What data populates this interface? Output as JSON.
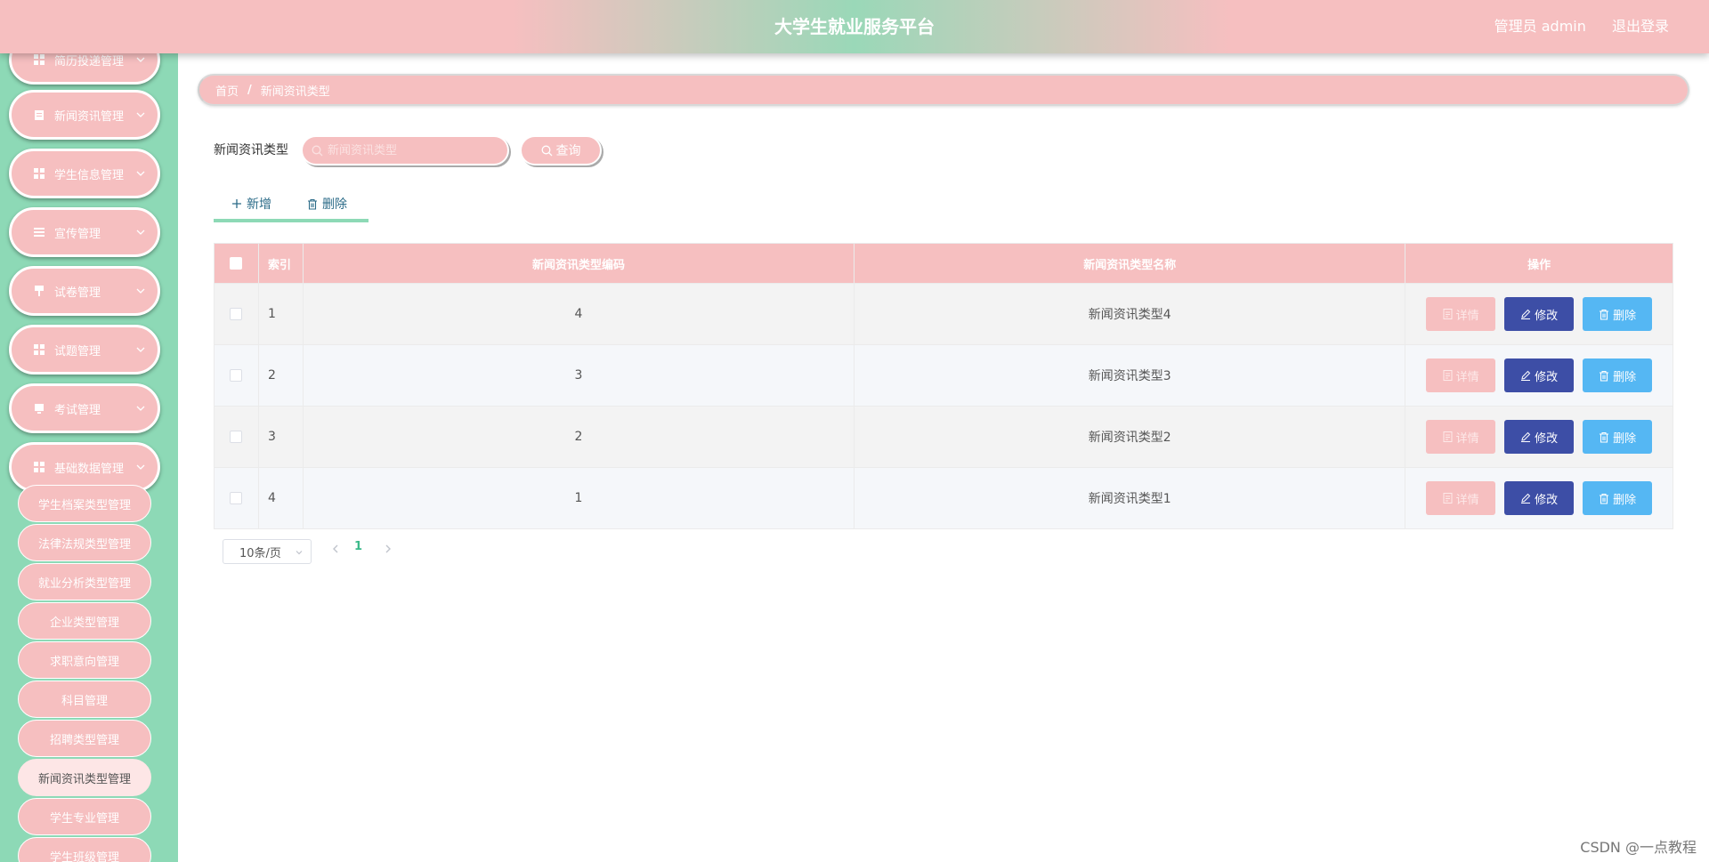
{
  "header": {
    "title": "大学生就业服务平台",
    "user": "管理员 admin",
    "logout": "退出登录"
  },
  "sidebar": {
    "menus": [
      {
        "label": "简历投递管理",
        "icon": "grid-icon"
      },
      {
        "label": "新闻资讯管理",
        "icon": "clipboard-icon"
      },
      {
        "label": "学生信息管理",
        "icon": "grid-icon"
      },
      {
        "label": "宣传管理",
        "icon": "list-icon"
      },
      {
        "label": "试卷管理",
        "icon": "stamp-icon"
      },
      {
        "label": "试题管理",
        "icon": "grid-icon"
      },
      {
        "label": "考试管理",
        "icon": "monitor-icon"
      },
      {
        "label": "基础数据管理",
        "icon": "grid-icon"
      }
    ],
    "submenus": [
      "学生档案类型管理",
      "法律法规类型管理",
      "就业分析类型管理",
      "企业类型管理",
      "求职意向管理",
      "科目管理",
      "招聘类型管理",
      "新闻资讯类型管理",
      "学生专业管理",
      "学生班级管理"
    ],
    "active_submenu": "新闻资讯类型管理"
  },
  "breadcrumb": {
    "home": "首页",
    "separator": "/",
    "current": "新闻资讯类型"
  },
  "search": {
    "label": "新闻资讯类型",
    "placeholder": "新闻资讯类型",
    "query_label": "查询"
  },
  "actions": {
    "add_label": "新增",
    "delete_label": "删除"
  },
  "table": {
    "columns": [
      "索引",
      "新闻资讯类型编码",
      "新闻资讯类型名称",
      "操作"
    ],
    "rows": [
      {
        "index": "1",
        "code": "4",
        "name": "新闻资讯类型4"
      },
      {
        "index": "2",
        "code": "3",
        "name": "新闻资讯类型3"
      },
      {
        "index": "3",
        "code": "2",
        "name": "新闻资讯类型2"
      },
      {
        "index": "4",
        "code": "1",
        "name": "新闻资讯类型1"
      }
    ],
    "op_labels": {
      "detail": "详情",
      "edit": "修改",
      "delete": "删除"
    }
  },
  "pagination": {
    "page_size": "10条/页",
    "current_page": "1"
  },
  "watermark": "CSDN @一点教程",
  "colors": {
    "primary_pink": "#f6bfc0",
    "sidebar_green": "#8dd9b6",
    "edit_blue": "#3d4ea6",
    "delete_blue": "#55b7f3"
  }
}
